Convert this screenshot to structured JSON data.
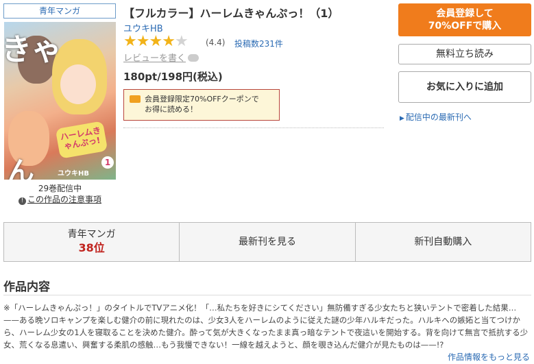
{
  "genre_tag": "青年マンガ",
  "cover": {
    "logo_text": "ハーレムきゃんぷっ!",
    "volume_badge": "1",
    "author_on_cover": "ユウキHB",
    "kana_top": "きゃ",
    "kana_bottom": "ん"
  },
  "volume_count": "29巻配信中",
  "notice_link": "この作品の注意事項",
  "title": "【フルカラー】ハーレムきゃんぷっ！（1）",
  "author": "ユウキHB",
  "rating": {
    "stars": 4,
    "max": 5,
    "value_text": "(4.4)",
    "reviews_link": "投稿数231件"
  },
  "write_review": "レビューを書く",
  "price": "180pt/198円(税込)",
  "coupon": {
    "line1": "会員登録限定70%OFFクーポンで",
    "line2": "お得に読める！"
  },
  "buttons": {
    "register_line1": "会員登録して",
    "register_line2": "70%OFFで購入",
    "free_read": "無料立ち読み",
    "favorite": "お気に入りに追加"
  },
  "latest_link": "配信中の最新刊へ",
  "tabs": {
    "rank_genre": "青年マンガ",
    "rank_value": "38位",
    "latest": "最新刊を見る",
    "auto_buy": "新刊自動購入"
  },
  "section_title": "作品内容",
  "description": "※「ハーレムきゃんぷっ！」のタイトルでTVアニメ化！「…私たちを好きにシてください」無防備すぎる少女たちと狭いテントで密着した結果…——ある晩ソロキャンプを楽しむ健介の前に現れたのは、少女3人をハーレムのように従えた謎の少年ハルキだった。ハルキへの嫉妬と当てつけから、ハーレム少女の1人を寝取ることを決めた健介。酔って気が大きくなったまま真っ暗なテントで夜這いを開始する。背を向けて無言で抵抗する少女、荒くなる息遣い、興奮する柔肌の感触…もう我慢できない！一線を越えようと、顔を覗き込んだ健介が見たものは——!?",
  "more_link": "作品情報をもっと見る",
  "colors": {
    "accent": "#f07c1c",
    "link": "#2a6ab3",
    "rank": "#c0231e",
    "star": "#f2b319"
  }
}
